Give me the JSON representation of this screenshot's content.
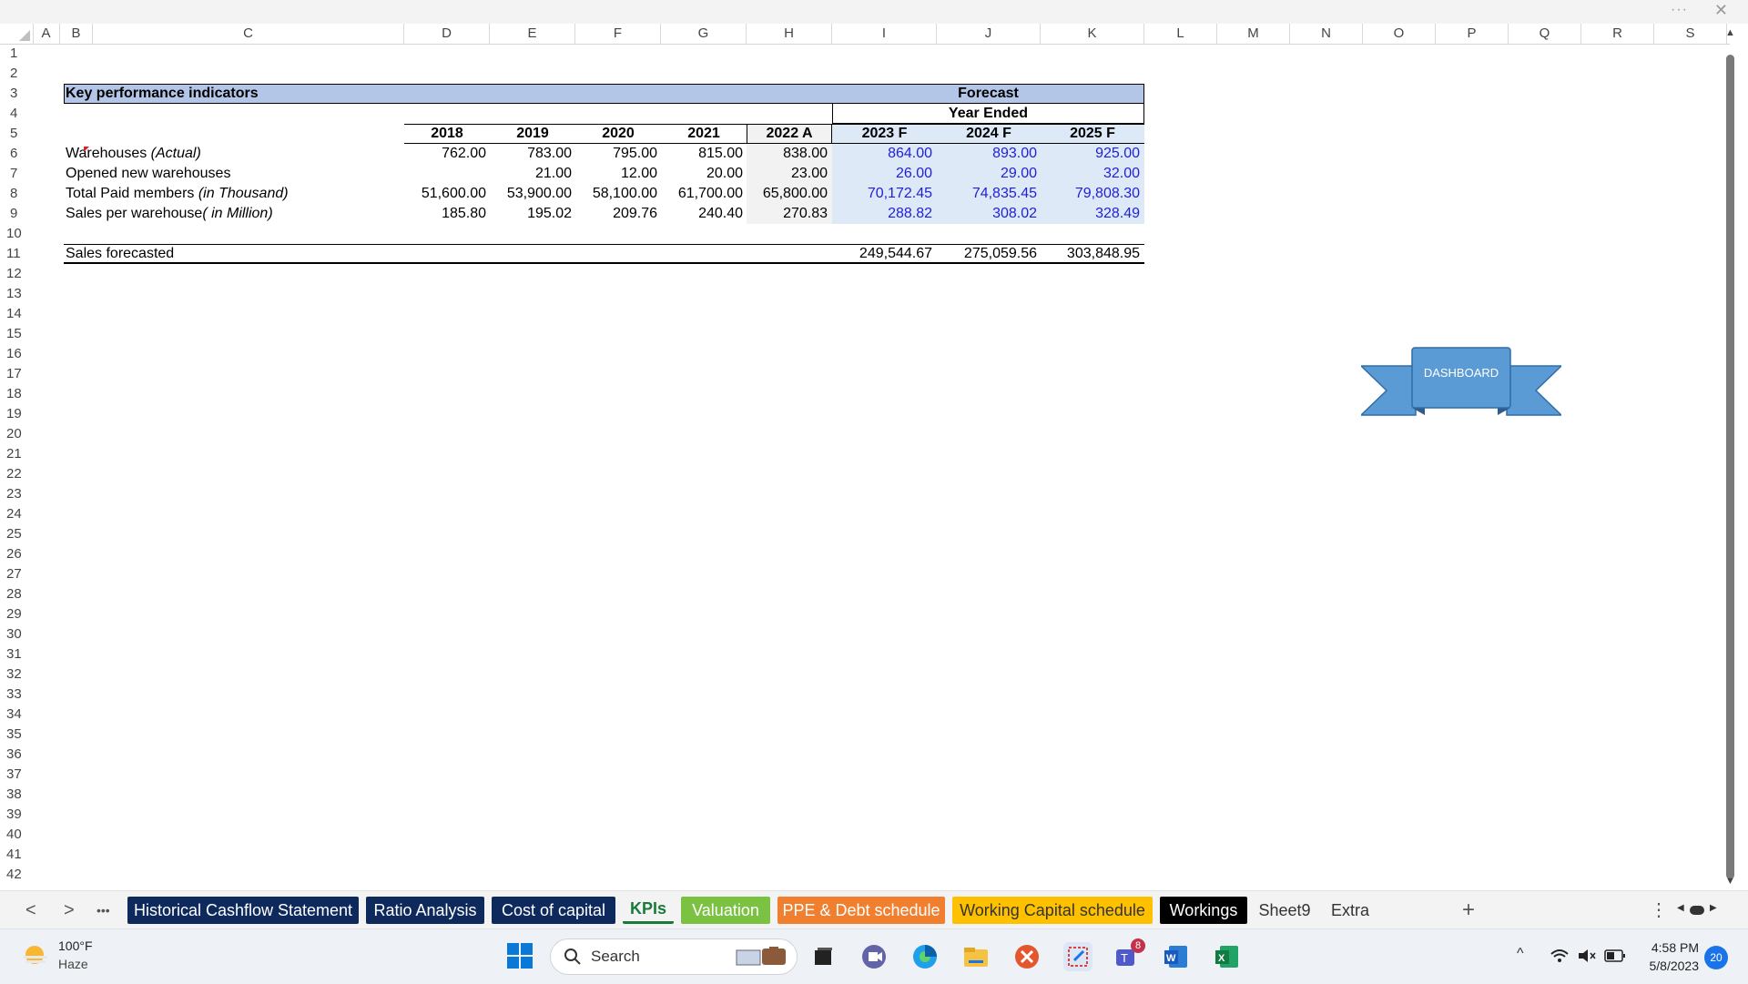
{
  "columns": [
    "A",
    "B",
    "C",
    "D",
    "E",
    "F",
    "G",
    "H",
    "I",
    "J",
    "K",
    "L",
    "M",
    "N",
    "O",
    "P",
    "Q",
    "R",
    "S"
  ],
  "rows": [
    "1",
    "2",
    "3",
    "4",
    "5",
    "6",
    "7",
    "8",
    "9",
    "10",
    "11",
    "12",
    "13",
    "14",
    "15",
    "16",
    "17",
    "18",
    "19",
    "20",
    "21",
    "22",
    "23",
    "24",
    "25",
    "26",
    "27",
    "28",
    "29",
    "30",
    "31",
    "32",
    "33",
    "34",
    "35",
    "36",
    "37",
    "38",
    "39",
    "40",
    "41",
    "42"
  ],
  "sheet": {
    "title": "Key performance indicators",
    "forecast_label": "Forecast",
    "year_ended_label": "Year Ended",
    "years": [
      "2018",
      "2019",
      "2020",
      "2021",
      "2022 A",
      "2023 F",
      "2024 F",
      "2025 F"
    ],
    "kpi_rows": [
      {
        "label_main": "Warehouses ",
        "label_italic": "(Actual)",
        "values": [
          "762.00",
          "783.00",
          "795.00",
          "815.00",
          "838.00",
          "864.00",
          "893.00",
          "925.00"
        ]
      },
      {
        "label_main": "Opened new warehouses",
        "label_italic": "",
        "values": [
          "",
          "21.00",
          "12.00",
          "20.00",
          "23.00",
          "26.00",
          "29.00",
          "32.00"
        ]
      },
      {
        "label_main": "Total Paid members ",
        "label_italic": "(in Thousand)",
        "values": [
          "51,600.00",
          "53,900.00",
          "58,100.00",
          "61,700.00",
          "65,800.00",
          "70,172.45",
          "74,835.45",
          "79,808.30"
        ]
      },
      {
        "label_main": "Sales per warehouse",
        "label_italic": "( in Million)",
        "values": [
          "185.80",
          "195.02",
          "209.76",
          "240.40",
          "270.83",
          "288.82",
          "308.02",
          "328.49"
        ]
      }
    ],
    "sales_forecasted_label": "Sales forecasted",
    "sales_forecasted_values": [
      "249,544.67",
      "275,059.56",
      "303,848.95"
    ],
    "dashboard_button": "DASHBOARD"
  },
  "tabs": [
    {
      "label": "Historical Cashflow Statement",
      "bg": "#0e2a5c",
      "fg": "#ffffff"
    },
    {
      "label": "Ratio Analysis",
      "bg": "#0e2a5c",
      "fg": "#ffffff"
    },
    {
      "label": "Cost of capital",
      "bg": "#0e2a5c",
      "fg": "#ffffff"
    },
    {
      "label": "KPIs",
      "bg": "#f3f3f3",
      "fg": "#1a7a3a"
    },
    {
      "label": "Valuation",
      "bg": "#7cc242",
      "fg": "#ffffff"
    },
    {
      "label": "PPE & Debt schedule",
      "bg": "#f08030",
      "fg": "#ffffff"
    },
    {
      "label": "Working Capital schedule",
      "bg": "#ffc000",
      "fg": "#333333"
    },
    {
      "label": "Workings",
      "bg": "#000000",
      "fg": "#ffffff"
    },
    {
      "label": "Sheet9",
      "bg": "#f3f3f3",
      "fg": "#333333"
    },
    {
      "label": "Extra",
      "bg": "#f3f3f3",
      "fg": "#333333"
    }
  ],
  "tab_nav": {
    "prev": "<",
    "next": ">",
    "more": "•••",
    "add": "+",
    "menu": "⋮"
  },
  "window": {
    "dots": "···",
    "close": "✕"
  },
  "taskbar": {
    "weather_temp": "100°F",
    "weather_desc": "Haze",
    "search_placeholder": "Search",
    "time": "4:58 PM",
    "date": "5/8/2023",
    "notification_count": "20",
    "teams_badge": "8"
  },
  "icons": [
    "weather-icon",
    "windows-start-icon",
    "search-icon",
    "file-explorer-icon",
    "edge-icon",
    "teams-icon",
    "word-icon",
    "excel-icon",
    "wifi-icon",
    "volume-icon",
    "battery-icon"
  ],
  "colors": {
    "header_fill": "#b4c6e7",
    "forecast_fill": "#dde9f7",
    "forecast_text": "#1f1fd6",
    "dashboard_blue": "#5b9bd5"
  }
}
